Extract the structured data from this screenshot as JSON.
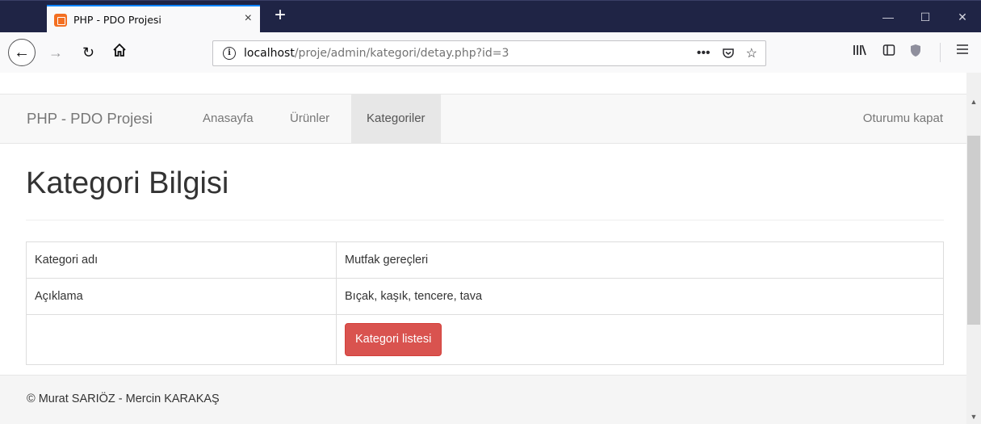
{
  "browser": {
    "tab_title": "PHP - PDO Projesi",
    "tab_close": "×",
    "new_tab": "+",
    "url_host": "localhost",
    "url_path": "/proje/admin/kategori/detay.php?id=3",
    "window_controls": {
      "minimize": "—",
      "maximize": "☐",
      "close": "✕"
    }
  },
  "navbar": {
    "brand": "PHP - PDO Projesi",
    "links": [
      "Anasayfa",
      "Ürünler",
      "Kategoriler"
    ],
    "active_link": "Kategoriler",
    "logout": "Oturumu kapat"
  },
  "page": {
    "title": "Kategori Bilgisi",
    "rows": [
      {
        "label": "Kategori adı",
        "value": "Mutfak gereçleri"
      },
      {
        "label": "Açıklama",
        "value": "Bıçak, kaşık, tencere, tava"
      }
    ],
    "list_button": "Kategori listesi"
  },
  "footer": {
    "text": "© Murat SARIÖZ - Mercin KARAKAŞ"
  },
  "colors": {
    "titlebar": "#1f2445",
    "tab_accent": "#0a84ff",
    "danger": "#d9534f",
    "navbar_bg": "#f8f8f8"
  },
  "icons": {
    "back": "arrow-left-icon",
    "forward": "arrow-right-icon",
    "reload": "reload-icon",
    "home": "home-icon",
    "info": "info-icon",
    "page_actions": "more-icon",
    "pocket": "pocket-icon",
    "bookmark": "star-icon",
    "library": "library-icon",
    "sidebar": "sidebar-icon",
    "tracking": "shield-icon",
    "menu": "hamburger-menu-icon"
  }
}
